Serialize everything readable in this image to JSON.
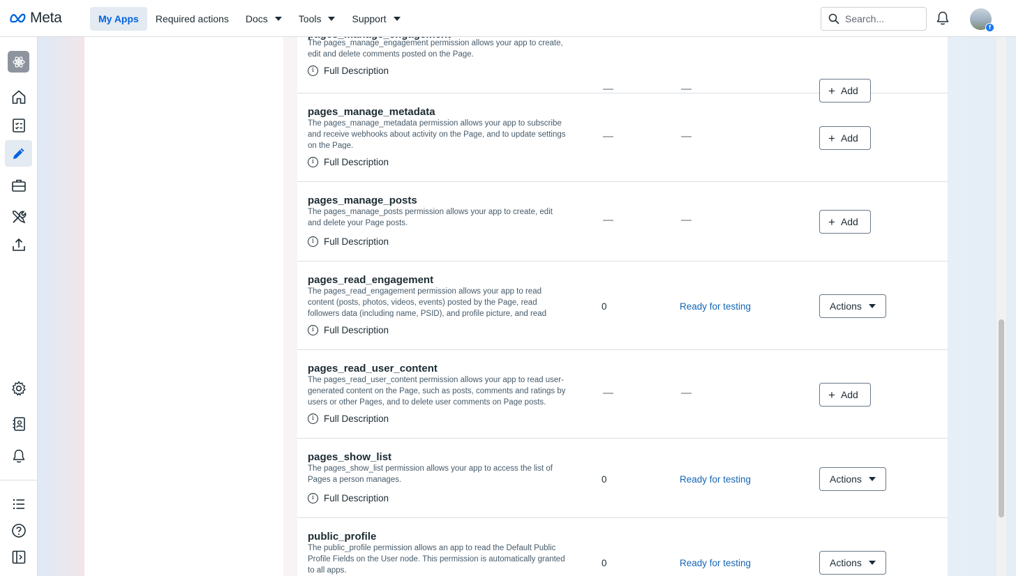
{
  "brand": {
    "name": "Meta"
  },
  "nav": {
    "items": [
      {
        "label": "My Apps",
        "active": true,
        "dropdown": false
      },
      {
        "label": "Required actions",
        "active": false,
        "dropdown": false
      },
      {
        "label": "Docs",
        "active": false,
        "dropdown": true
      },
      {
        "label": "Tools",
        "active": false,
        "dropdown": true
      },
      {
        "label": "Support",
        "active": false,
        "dropdown": true
      }
    ],
    "search_placeholder": "Search..."
  },
  "rail": {
    "top_icons": [
      "app-icon",
      "home-icon",
      "checklist-icon",
      "pencil-icon",
      "briefcase-icon",
      "tools-icon",
      "upload-icon"
    ],
    "bottom_icons": [
      "gear-icon",
      "contacts-icon",
      "bell-icon",
      "list-icon",
      "help-icon",
      "sidebar-toggle-icon"
    ],
    "active": "pencil-icon"
  },
  "permissions": {
    "full_description_label": "Full Description",
    "rows": [
      {
        "name": "pages_manage_engagement",
        "description": "The pages_manage_engagement permission allows your app to create, edit and delete comments posted on the Page.",
        "count": "",
        "status": "",
        "action": "Add"
      },
      {
        "name": "pages_manage_metadata",
        "description": "The pages_manage_metadata permission allows your app to subscribe and receive webhooks about activity on the Page, and to update settings on the Page.",
        "count": "",
        "status": "",
        "action": "Add"
      },
      {
        "name": "pages_manage_posts",
        "description": "The pages_manage_posts permission allows your app to create, edit and delete your Page posts.",
        "count": "",
        "status": "",
        "action": "Add"
      },
      {
        "name": "pages_read_engagement",
        "description": "The pages_read_engagement permission allows your app to read content (posts, photos, videos, events) posted by the Page, read followers data (including name, PSID), and profile picture, and read",
        "count": "0",
        "status": "Ready for testing",
        "action": "Actions"
      },
      {
        "name": "pages_read_user_content",
        "description": "The pages_read_user_content permission allows your app to read user-generated content on the Page, such as posts, comments and ratings by users or other Pages, and to delete user comments on Page posts.",
        "count": "",
        "status": "",
        "action": "Add"
      },
      {
        "name": "pages_show_list",
        "description": "The pages_show_list permission allows your app to access the list of Pages a person manages.",
        "count": "0",
        "status": "Ready for testing",
        "action": "Actions"
      },
      {
        "name": "public_profile",
        "description": "The public_profile permission allows an app to read the Default Public Profile Fields on the User node. This permission is automatically granted to all apps.",
        "count": "0",
        "status": "Ready for testing",
        "action": "Actions"
      }
    ]
  }
}
